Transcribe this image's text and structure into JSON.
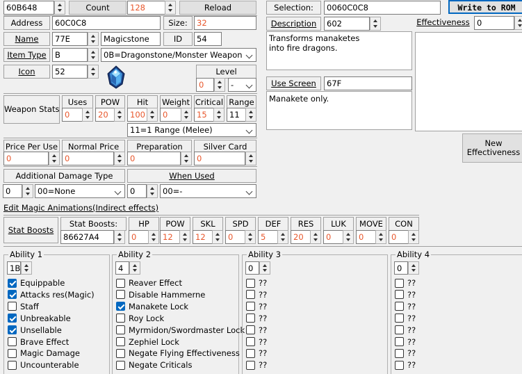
{
  "header": {
    "search_value": "60B648",
    "count_label": "Count",
    "count_value": "128",
    "reload_label": "Reload",
    "selection_label": "Selection:",
    "selection_value": "0060C0C8",
    "write_label": "Write to ROM"
  },
  "item": {
    "address_label": "Address",
    "address_value": "60C0C8",
    "size_label": "Size:",
    "size_value": "32",
    "name_label": "Name",
    "name_value": "77E",
    "name_text": "Magicstone",
    "id_label": "ID",
    "id_value": "54",
    "type_label": "Item Type",
    "type_value": "B",
    "type_text": "0B=Dragonstone/Monster Weapon",
    "icon_label": "Icon",
    "icon_value": "52",
    "level_label": "Level",
    "level_value": "0",
    "level_text": "-"
  },
  "description": {
    "label": "Description",
    "value": "602",
    "text_line1": "Transforms manaketes",
    "text_line2": "into fire dragons."
  },
  "use_screen": {
    "label": "Use Screen",
    "value": "67F",
    "text": "Manakete only."
  },
  "effectiveness": {
    "label": "Effectiveness",
    "value": "0",
    "new_label_1": "New",
    "new_label_2": "Effectiveness"
  },
  "weapon": {
    "label": "Weapon Stats",
    "headers": [
      "Uses",
      "POW",
      "Hit",
      "Weight",
      "Critical",
      "Range"
    ],
    "values": [
      "0",
      "20",
      "100",
      "0",
      "15",
      "11"
    ],
    "range_text": "11=1 Range (Melee)"
  },
  "price": {
    "headers": [
      "Price Per Use",
      "Normal Price",
      "Preparation",
      "Silver Card"
    ],
    "values": [
      "0",
      "0",
      "0",
      "0"
    ]
  },
  "damage": {
    "label": "Additional Damage Type",
    "value": "0",
    "text": "00=None",
    "when_label": "When Used",
    "when_value": "0",
    "when_text": "00=-"
  },
  "magic_link": "Edit Magic Animations(Indirect effects)",
  "boosts": {
    "label": "Stat Boosts",
    "sub_label": "Stat Boosts:",
    "pointer": "86627A4",
    "headers": [
      "HP",
      "POW",
      "SKL",
      "SPD",
      "DEF",
      "RES",
      "LUK",
      "MOVE",
      "CON"
    ],
    "values": [
      "0",
      "12",
      "12",
      "0",
      "5",
      "20",
      "0",
      "0",
      "0"
    ]
  },
  "abilities": [
    {
      "title": "Ability 1",
      "value": "1B",
      "items": [
        {
          "label": "Equippable",
          "checked": true
        },
        {
          "label": "Attacks res(Magic)",
          "checked": true
        },
        {
          "label": "Staff",
          "checked": false
        },
        {
          "label": "Unbreakable",
          "checked": true
        },
        {
          "label": "Unsellable",
          "checked": true
        },
        {
          "label": "Brave Effect",
          "checked": false
        },
        {
          "label": "Magic Damage",
          "checked": false
        },
        {
          "label": "Uncounterable",
          "checked": false
        }
      ]
    },
    {
      "title": "Ability 2",
      "value": "4",
      "items": [
        {
          "label": "Reaver Effect",
          "checked": false
        },
        {
          "label": "Disable Hammerne",
          "checked": false
        },
        {
          "label": "Manakete Lock",
          "checked": true
        },
        {
          "label": "Roy Lock",
          "checked": false
        },
        {
          "label": "Myrmidon/Swordmaster Lock",
          "checked": false
        },
        {
          "label": "Zephiel Lock",
          "checked": false
        },
        {
          "label": "Negate Flying Effectiveness",
          "checked": false
        },
        {
          "label": "Negate Criticals",
          "checked": false
        }
      ]
    },
    {
      "title": "Ability 3",
      "value": "0",
      "items": [
        {
          "label": "??",
          "checked": false
        },
        {
          "label": "??",
          "checked": false
        },
        {
          "label": "??",
          "checked": false
        },
        {
          "label": "??",
          "checked": false
        },
        {
          "label": "??",
          "checked": false
        },
        {
          "label": "??",
          "checked": false
        },
        {
          "label": "??",
          "checked": false
        },
        {
          "label": "??",
          "checked": false
        }
      ]
    },
    {
      "title": "Ability 4",
      "value": "0",
      "items": [
        {
          "label": "??",
          "checked": false
        },
        {
          "label": "??",
          "checked": false
        },
        {
          "label": "??",
          "checked": false
        },
        {
          "label": "??",
          "checked": false
        },
        {
          "label": "??",
          "checked": false
        },
        {
          "label": "??",
          "checked": false
        },
        {
          "label": "??",
          "checked": false
        },
        {
          "label": "??",
          "checked": false
        }
      ]
    }
  ]
}
